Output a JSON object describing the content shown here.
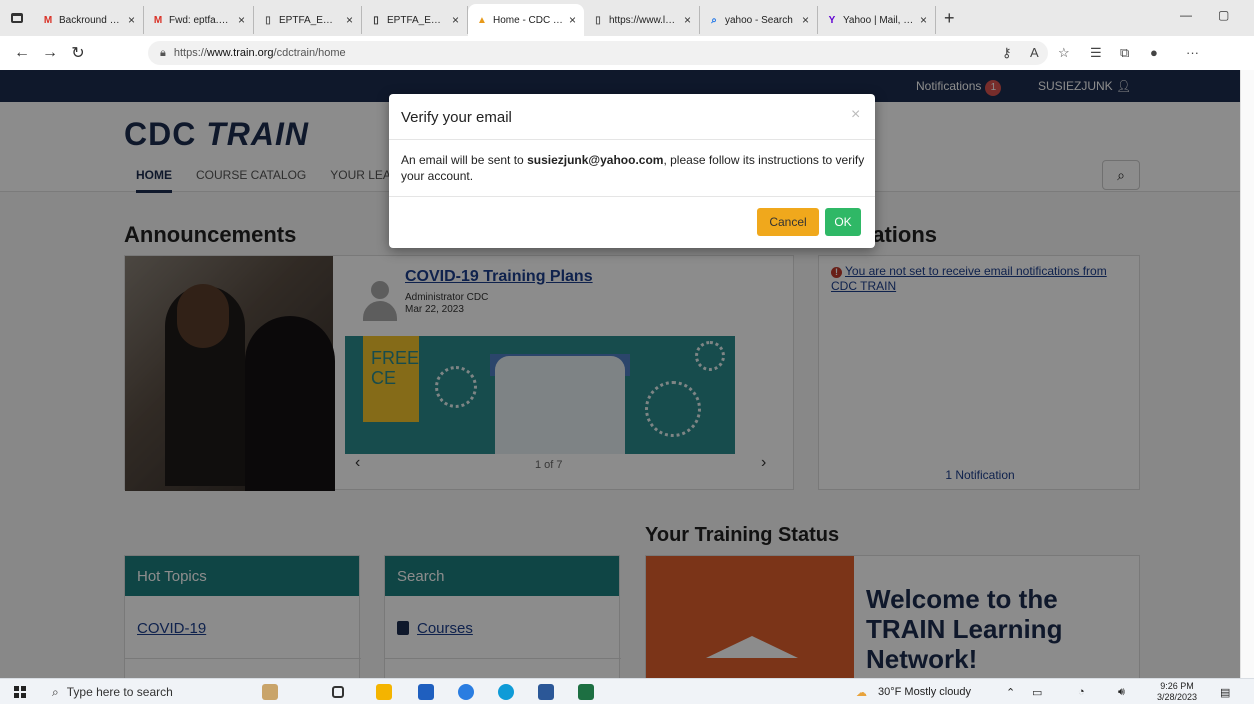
{
  "browser": {
    "tabs": [
      {
        "title": "Backround screen",
        "icon": "gmail-icon",
        "icon_glyph": "M",
        "icon_color": "#d93025"
      },
      {
        "title": "Fwd: eptfa.org - N",
        "icon": "gmail-icon",
        "icon_glyph": "M",
        "icon_color": "#d93025"
      },
      {
        "title": "EPTFA_Email.pdf",
        "icon": "document-icon",
        "icon_glyph": "▯",
        "icon_color": "#555555"
      },
      {
        "title": "EPTFA_Email.pdf",
        "icon": "document-icon",
        "icon_glyph": "▯",
        "icon_color": "#333333"
      },
      {
        "title": "Home - CDC TRAI",
        "icon": "train-icon",
        "icon_glyph": "▲",
        "icon_color": "#e89a1a",
        "active": true
      },
      {
        "title": "https://www.leagu",
        "icon": "document-icon",
        "icon_glyph": "▯",
        "icon_color": "#555555"
      },
      {
        "title": "yahoo - Search",
        "icon": "search-icon",
        "icon_glyph": "⌕",
        "icon_color": "#1a73e8"
      },
      {
        "title": "Yahoo | Mail, Wea",
        "icon": "yahoo-icon",
        "icon_glyph": "Y",
        "icon_color": "#6001d2"
      }
    ],
    "url_prefix": "https://",
    "url_host": "www.train.org",
    "url_path": "/cdctrain/home"
  },
  "topnav": {
    "notifications_label": "Notifications",
    "notifications_count": "1",
    "user": "SUSIEZJUNK"
  },
  "header": {
    "logo_cdc": "CDC",
    "logo_train": "TRAIN",
    "menu": [
      "HOME",
      "COURSE CATALOG",
      "YOUR LEA"
    ]
  },
  "announcements": {
    "heading": "Announcements",
    "title": "COVID-19 Training Plans",
    "author": "Administrator CDC",
    "date": "Mar 22, 2023",
    "banner_text": "FREE CE",
    "counter": "1 of 7"
  },
  "notifications": {
    "heading": "cations",
    "warning_link": "You are not set to receive email notifications from CDC TRAIN",
    "count_text": "1 Notification"
  },
  "training_status": {
    "heading": "Your Training Status",
    "welcome": "Welcome to the TRAIN Learning Network!"
  },
  "hot_topics": {
    "heading": "Hot Topics",
    "link": "COVID-19"
  },
  "search_card": {
    "heading": "Search",
    "link": "Courses"
  },
  "modal": {
    "title": "Verify your email",
    "close": "×",
    "body_before": "An email will be sent to ",
    "email": "susiezjunk@yahoo.com",
    "body_after": ", please follow its instructions to verify your account.",
    "cancel": "Cancel",
    "ok": "OK"
  },
  "taskbar": {
    "search_placeholder": "Type here to search",
    "weather": "30°F  Mostly cloudy",
    "time": "9:26 PM",
    "date": "3/28/2023"
  },
  "colors": {
    "navy": "#1c2d4f",
    "teal": "#1d7f7f",
    "orange": "#e05f2c",
    "cancel_yellow": "#f0a81c",
    "ok_green": "#2fb866"
  }
}
